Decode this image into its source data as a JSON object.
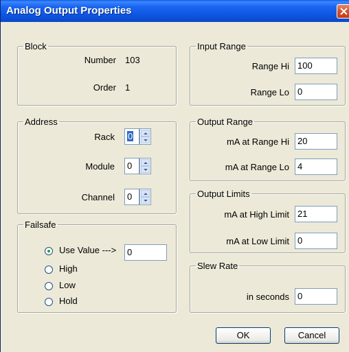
{
  "window": {
    "title": "Analog Output Properties"
  },
  "block": {
    "legend": "Block",
    "number_label": "Number",
    "number_value": "103",
    "order_label": "Order",
    "order_value": "1"
  },
  "address": {
    "legend": "Address",
    "rack_label": "Rack",
    "rack_value": "0",
    "module_label": "Module",
    "module_value": "0",
    "channel_label": "Channel",
    "channel_value": "0"
  },
  "failsafe": {
    "legend": "Failsafe",
    "options": [
      "Use Value --->",
      "High",
      "Low",
      "Hold"
    ],
    "selected": "Use Value --->",
    "value": "0"
  },
  "input_range": {
    "legend": "Input Range",
    "hi_label": "Range Hi",
    "hi_value": "100",
    "lo_label": "Range Lo",
    "lo_value": "0"
  },
  "output_range": {
    "legend": "Output Range",
    "hi_label": "mA at Range Hi",
    "hi_value": "20",
    "lo_label": "mA at Range Lo",
    "lo_value": "4"
  },
  "output_limits": {
    "legend": "Output Limits",
    "high_label": "mA at High Limit",
    "high_value": "21",
    "low_label": "mA at Low Limit",
    "low_value": "0"
  },
  "slew_rate": {
    "legend": "Slew Rate",
    "label": "in seconds",
    "value": "0"
  },
  "buttons": {
    "ok": "OK",
    "cancel": "Cancel"
  },
  "icons": {
    "close": "close-icon",
    "spin_up": "arrow-up-icon",
    "spin_down": "arrow-down-icon"
  },
  "colors": {
    "titlebar": "#0a5fe0",
    "dialog_bg": "#ece9d8",
    "close_button": "#d2512b",
    "radio_dot": "#21a121"
  }
}
